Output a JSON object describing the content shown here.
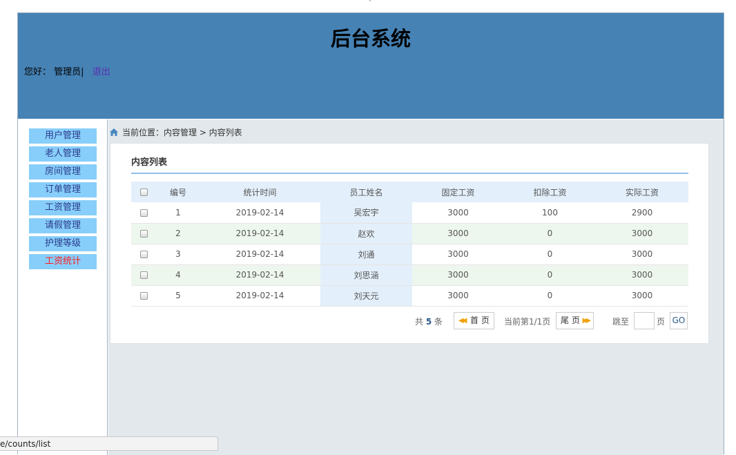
{
  "tick_mark": "`",
  "header": {
    "title": "后台系统",
    "greeting": "您好：",
    "username": "管理员|",
    "logout": "退出"
  },
  "sidebar": {
    "items": [
      {
        "label": "用户管理"
      },
      {
        "label": "老人管理"
      },
      {
        "label": "房间管理"
      },
      {
        "label": "订单管理"
      },
      {
        "label": "工资管理"
      },
      {
        "label": "请假管理"
      },
      {
        "label": "护理等级"
      },
      {
        "label": "工资统计"
      }
    ],
    "active_index": 7
  },
  "breadcrumb": {
    "text": "当前位置：内容管理 > 内容列表"
  },
  "panel": {
    "title": "内容列表"
  },
  "table": {
    "headers": [
      "编号",
      "统计时间",
      "员工姓名",
      "固定工资",
      "扣除工资",
      "实际工资"
    ],
    "rows": [
      {
        "id": "1",
        "date": "2019-02-14",
        "name": "吴宏宇",
        "fixed": "3000",
        "deduct": "100",
        "actual": "2900"
      },
      {
        "id": "2",
        "date": "2019-02-14",
        "name": "赵欢",
        "fixed": "3000",
        "deduct": "0",
        "actual": "3000"
      },
      {
        "id": "3",
        "date": "2019-02-14",
        "name": "刘通",
        "fixed": "3000",
        "deduct": "0",
        "actual": "3000"
      },
      {
        "id": "4",
        "date": "2019-02-14",
        "name": "刘思涵",
        "fixed": "3000",
        "deduct": "0",
        "actual": "3000"
      },
      {
        "id": "5",
        "date": "2019-02-14",
        "name": "刘天元",
        "fixed": "3000",
        "deduct": "0",
        "actual": "3000"
      }
    ]
  },
  "pager": {
    "total_prefix": "共",
    "total_count": "5",
    "total_suffix": "条",
    "first_label": "首 页",
    "current": "当前第1/1页",
    "last_label": "尾 页",
    "jump_label": "跳至",
    "page_label": "页",
    "go_label": "GO"
  },
  "status_bar": {
    "url": "e/counts/list"
  },
  "colors": {
    "header_bg": "#4682b4",
    "nav_bg": "#87cefa",
    "active_nav": "#ff1a1a",
    "main_bg": "#e2e8eb"
  }
}
